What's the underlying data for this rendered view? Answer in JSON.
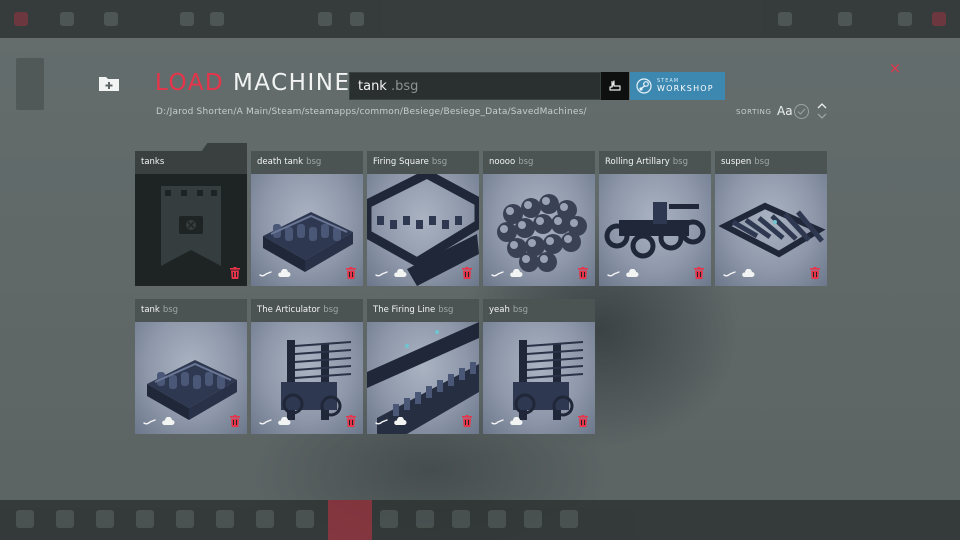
{
  "header": {
    "title_accent": "LOAD",
    "title_main": "MACHINE",
    "path": "D:/Jarod Shorten/A Main/Steam/steamapps/common/Besiege/Besiege_Data/SavedMachines/",
    "search_value": "tank",
    "search_extension": ".bsg",
    "workshop_line1": "STEAM",
    "workshop_line2": "WORKSHOP",
    "close_label": "×",
    "sorting_label": "SORTING",
    "sort_mode": "Aa"
  },
  "colors": {
    "accent": "#e8344b",
    "workshop": "#3c88b0",
    "panel": "#4c5353"
  },
  "cards": [
    {
      "name": "tanks",
      "ext": "",
      "type": "folder"
    },
    {
      "name": "death tank",
      "ext": "bsg",
      "type": "machine",
      "icon": "tank"
    },
    {
      "name": "Firing Square",
      "ext": "bsg",
      "type": "machine",
      "icon": "square"
    },
    {
      "name": "noooo",
      "ext": "bsg",
      "type": "machine",
      "icon": "cluster"
    },
    {
      "name": "Rolling Artillary",
      "ext": "bsg",
      "type": "machine",
      "icon": "artillery"
    },
    {
      "name": "suspen",
      "ext": "bsg",
      "type": "machine",
      "icon": "suspension"
    },
    {
      "name": "tank",
      "ext": "bsg",
      "type": "machine",
      "icon": "tank"
    },
    {
      "name": "The Articulator",
      "ext": "bsg",
      "type": "machine",
      "icon": "tower"
    },
    {
      "name": "The Firing Line",
      "ext": "bsg",
      "type": "machine",
      "icon": "line"
    },
    {
      "name": "yeah",
      "ext": "bsg",
      "type": "machine",
      "icon": "tower"
    }
  ]
}
